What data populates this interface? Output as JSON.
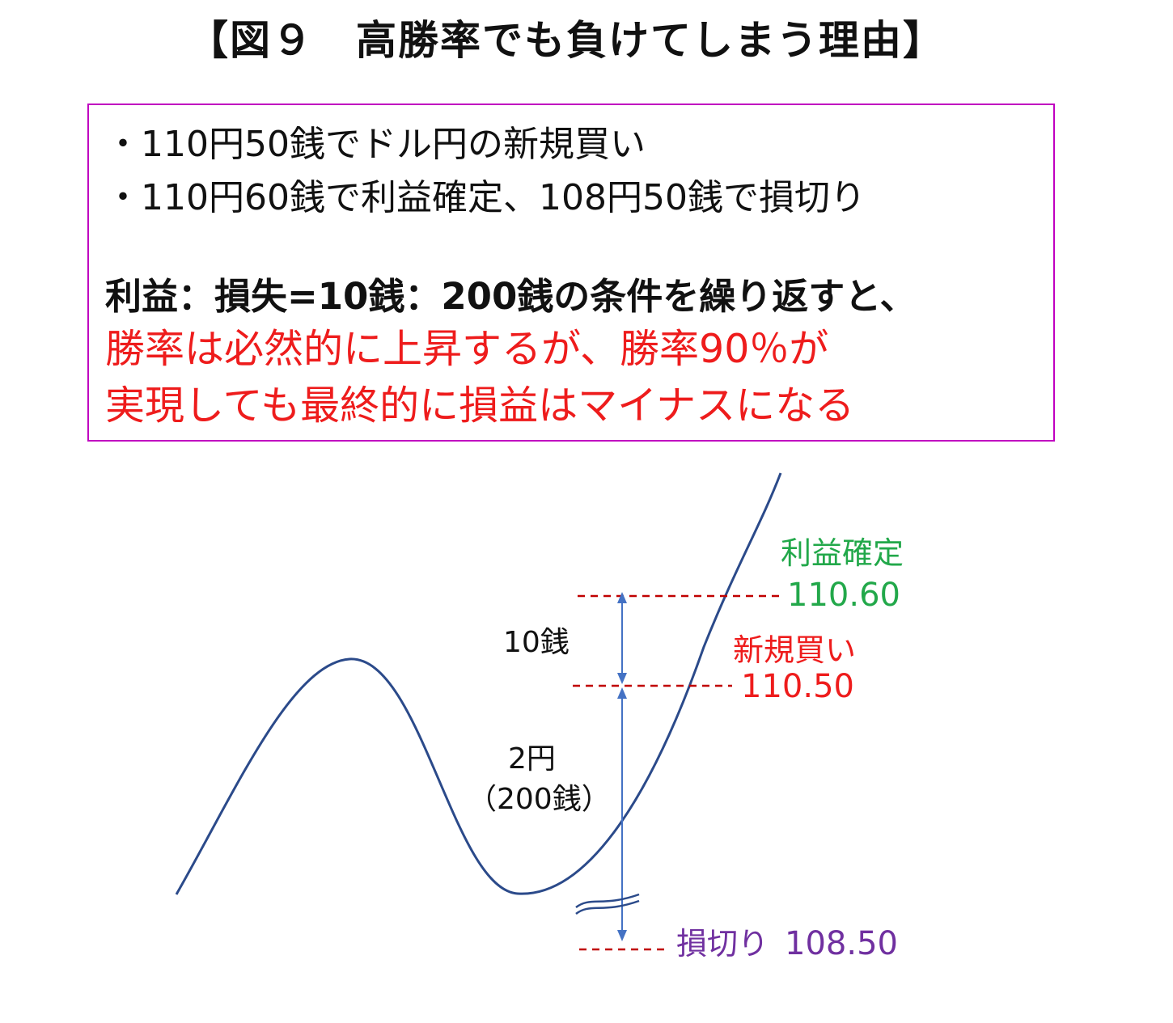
{
  "title": "【図９　高勝率でも負けてしまう理由】",
  "box": {
    "bullet1": "・110円50銭でドル円の新規買い",
    "bullet2": "・110円60銭で利益確定、108円50銭で損切り",
    "bold_line": "利益：損失=10銭：200銭の条件を繰り返すと、",
    "red_line1": "勝率は必然的に上昇するが、勝率90％が",
    "red_line2": "実現しても最終的に損益はマイナスになる"
  },
  "diagram": {
    "take_profit_label": "利益確定",
    "take_profit_value": "110.60",
    "entry_label": "新規買い",
    "entry_value": "110.50",
    "stop_loss_label": "損切り",
    "stop_loss_value": "108.50",
    "gain_label": "10銭",
    "loss_label_1": "2円",
    "loss_label_2": "（200銭）",
    "colors": {
      "title_border": "#c000c0",
      "red": "#ee1c1c",
      "green": "#22a84a",
      "purple": "#7030a0",
      "curve": "#2b4a8a",
      "arrow": "#4472c4",
      "dash": "#c00000"
    }
  }
}
